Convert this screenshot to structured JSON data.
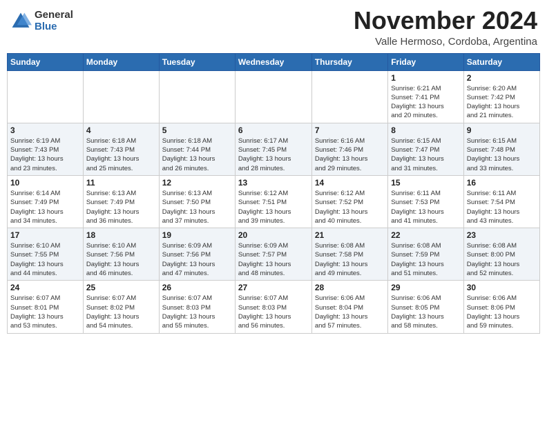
{
  "header": {
    "logo_general": "General",
    "logo_blue": "Blue",
    "month_title": "November 2024",
    "location": "Valle Hermoso, Cordoba, Argentina"
  },
  "weekdays": [
    "Sunday",
    "Monday",
    "Tuesday",
    "Wednesday",
    "Thursday",
    "Friday",
    "Saturday"
  ],
  "weeks": [
    [
      {
        "day": "",
        "info": ""
      },
      {
        "day": "",
        "info": ""
      },
      {
        "day": "",
        "info": ""
      },
      {
        "day": "",
        "info": ""
      },
      {
        "day": "",
        "info": ""
      },
      {
        "day": "1",
        "info": "Sunrise: 6:21 AM\nSunset: 7:41 PM\nDaylight: 13 hours\nand 20 minutes."
      },
      {
        "day": "2",
        "info": "Sunrise: 6:20 AM\nSunset: 7:42 PM\nDaylight: 13 hours\nand 21 minutes."
      }
    ],
    [
      {
        "day": "3",
        "info": "Sunrise: 6:19 AM\nSunset: 7:43 PM\nDaylight: 13 hours\nand 23 minutes."
      },
      {
        "day": "4",
        "info": "Sunrise: 6:18 AM\nSunset: 7:43 PM\nDaylight: 13 hours\nand 25 minutes."
      },
      {
        "day": "5",
        "info": "Sunrise: 6:18 AM\nSunset: 7:44 PM\nDaylight: 13 hours\nand 26 minutes."
      },
      {
        "day": "6",
        "info": "Sunrise: 6:17 AM\nSunset: 7:45 PM\nDaylight: 13 hours\nand 28 minutes."
      },
      {
        "day": "7",
        "info": "Sunrise: 6:16 AM\nSunset: 7:46 PM\nDaylight: 13 hours\nand 29 minutes."
      },
      {
        "day": "8",
        "info": "Sunrise: 6:15 AM\nSunset: 7:47 PM\nDaylight: 13 hours\nand 31 minutes."
      },
      {
        "day": "9",
        "info": "Sunrise: 6:15 AM\nSunset: 7:48 PM\nDaylight: 13 hours\nand 33 minutes."
      }
    ],
    [
      {
        "day": "10",
        "info": "Sunrise: 6:14 AM\nSunset: 7:49 PM\nDaylight: 13 hours\nand 34 minutes."
      },
      {
        "day": "11",
        "info": "Sunrise: 6:13 AM\nSunset: 7:49 PM\nDaylight: 13 hours\nand 36 minutes."
      },
      {
        "day": "12",
        "info": "Sunrise: 6:13 AM\nSunset: 7:50 PM\nDaylight: 13 hours\nand 37 minutes."
      },
      {
        "day": "13",
        "info": "Sunrise: 6:12 AM\nSunset: 7:51 PM\nDaylight: 13 hours\nand 39 minutes."
      },
      {
        "day": "14",
        "info": "Sunrise: 6:12 AM\nSunset: 7:52 PM\nDaylight: 13 hours\nand 40 minutes."
      },
      {
        "day": "15",
        "info": "Sunrise: 6:11 AM\nSunset: 7:53 PM\nDaylight: 13 hours\nand 41 minutes."
      },
      {
        "day": "16",
        "info": "Sunrise: 6:11 AM\nSunset: 7:54 PM\nDaylight: 13 hours\nand 43 minutes."
      }
    ],
    [
      {
        "day": "17",
        "info": "Sunrise: 6:10 AM\nSunset: 7:55 PM\nDaylight: 13 hours\nand 44 minutes."
      },
      {
        "day": "18",
        "info": "Sunrise: 6:10 AM\nSunset: 7:56 PM\nDaylight: 13 hours\nand 46 minutes."
      },
      {
        "day": "19",
        "info": "Sunrise: 6:09 AM\nSunset: 7:56 PM\nDaylight: 13 hours\nand 47 minutes."
      },
      {
        "day": "20",
        "info": "Sunrise: 6:09 AM\nSunset: 7:57 PM\nDaylight: 13 hours\nand 48 minutes."
      },
      {
        "day": "21",
        "info": "Sunrise: 6:08 AM\nSunset: 7:58 PM\nDaylight: 13 hours\nand 49 minutes."
      },
      {
        "day": "22",
        "info": "Sunrise: 6:08 AM\nSunset: 7:59 PM\nDaylight: 13 hours\nand 51 minutes."
      },
      {
        "day": "23",
        "info": "Sunrise: 6:08 AM\nSunset: 8:00 PM\nDaylight: 13 hours\nand 52 minutes."
      }
    ],
    [
      {
        "day": "24",
        "info": "Sunrise: 6:07 AM\nSunset: 8:01 PM\nDaylight: 13 hours\nand 53 minutes."
      },
      {
        "day": "25",
        "info": "Sunrise: 6:07 AM\nSunset: 8:02 PM\nDaylight: 13 hours\nand 54 minutes."
      },
      {
        "day": "26",
        "info": "Sunrise: 6:07 AM\nSunset: 8:03 PM\nDaylight: 13 hours\nand 55 minutes."
      },
      {
        "day": "27",
        "info": "Sunrise: 6:07 AM\nSunset: 8:03 PM\nDaylight: 13 hours\nand 56 minutes."
      },
      {
        "day": "28",
        "info": "Sunrise: 6:06 AM\nSunset: 8:04 PM\nDaylight: 13 hours\nand 57 minutes."
      },
      {
        "day": "29",
        "info": "Sunrise: 6:06 AM\nSunset: 8:05 PM\nDaylight: 13 hours\nand 58 minutes."
      },
      {
        "day": "30",
        "info": "Sunrise: 6:06 AM\nSunset: 8:06 PM\nDaylight: 13 hours\nand 59 minutes."
      }
    ]
  ]
}
